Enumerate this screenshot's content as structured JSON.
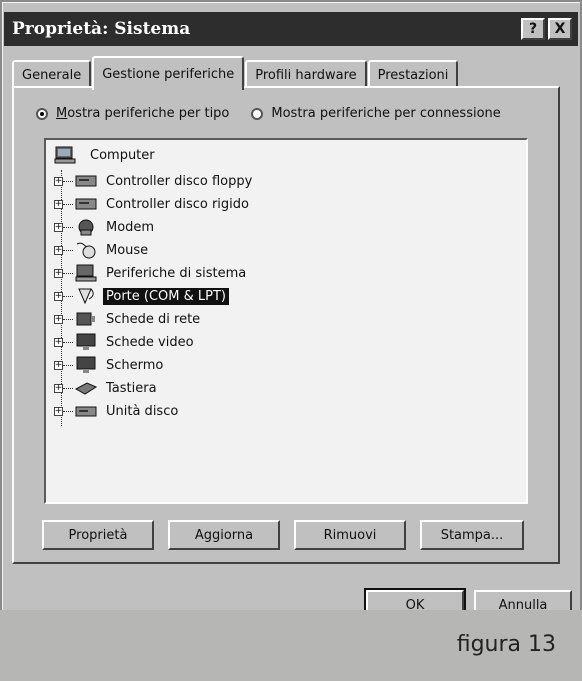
{
  "window": {
    "title": "Proprietà: Sistema"
  },
  "title_buttons": {
    "help": "?",
    "close": "X"
  },
  "tabs": [
    {
      "label": "Generale",
      "active": false
    },
    {
      "label": "Gestione periferiche",
      "active": true
    },
    {
      "label": "Profili hardware",
      "active": false
    },
    {
      "label": "Prestazioni",
      "active": false
    }
  ],
  "radios": [
    {
      "label": "Mostra periferiche per tipo",
      "checked": true
    },
    {
      "label": "Mostra periferiche per connessione",
      "checked": false
    }
  ],
  "tree": {
    "root": "Computer",
    "items": [
      {
        "label": "Controller disco floppy",
        "icon": "floppy-controller-icon",
        "selected": false
      },
      {
        "label": "Controller disco rigido",
        "icon": "hard-disk-controller-icon",
        "selected": false
      },
      {
        "label": "Modem",
        "icon": "modem-icon",
        "selected": false
      },
      {
        "label": "Mouse",
        "icon": "mouse-icon",
        "selected": false
      },
      {
        "label": "Periferiche di sistema",
        "icon": "system-devices-icon",
        "selected": false
      },
      {
        "label": "Porte (COM & LPT)",
        "icon": "ports-icon",
        "selected": true
      },
      {
        "label": "Schede di rete",
        "icon": "network-adapter-icon",
        "selected": false
      },
      {
        "label": "Schede video",
        "icon": "display-adapter-icon",
        "selected": false
      },
      {
        "label": "Schermo",
        "icon": "monitor-icon",
        "selected": false
      },
      {
        "label": "Tastiera",
        "icon": "keyboard-icon",
        "selected": false
      },
      {
        "label": "Unità disco",
        "icon": "disk-drive-icon",
        "selected": false
      }
    ]
  },
  "actions": {
    "properties": "Proprietà",
    "refresh": "Aggiorna",
    "remove": "Rimuovi",
    "print": "Stampa..."
  },
  "dialog_buttons": {
    "ok": "OK",
    "cancel": "Annulla"
  },
  "caption": "figura 13"
}
